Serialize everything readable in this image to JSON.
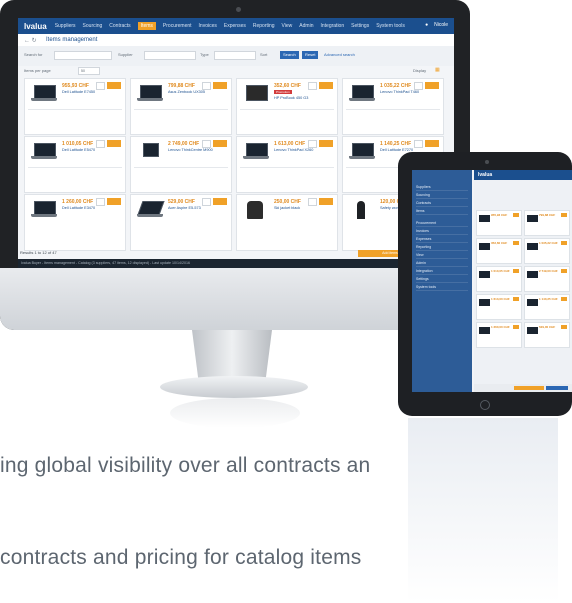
{
  "app": {
    "logo": "Ivalua",
    "nav": [
      "Suppliers",
      "Sourcing",
      "Contracts",
      "Items",
      "Procurement",
      "Invoices",
      "Expenses",
      "Reporting",
      "View",
      "Admin",
      "Integration",
      "Settings",
      "System tools"
    ],
    "active_nav": "Items",
    "user": "Nicole",
    "page_title": "Items management",
    "filters": {
      "search_label": "Search for",
      "supplier_label": "Supplier",
      "type_label": "Type",
      "sort_label": "Sort",
      "search_button": "Search",
      "reset_button": "Reset",
      "advanced_link": "Advanced search",
      "per_page_label": "Items per page",
      "per_page_value": "50",
      "display_label": "Display"
    },
    "products": [
      {
        "price": "955,93 CHF",
        "name": "Dell Latitude E7450",
        "image": "laptop"
      },
      {
        "price": "799,88 CHF",
        "name": "Asus Zenbook UX305",
        "image": "laptop"
      },
      {
        "price": "352,60 CHF",
        "name": "HP ProBook 450 G3",
        "image": "printer",
        "badge": "Promotion"
      },
      {
        "price": "1 035,22 CHF",
        "name": "Lenovo ThinkPad T460",
        "image": "laptop"
      },
      {
        "price": "1 010,05 CHF",
        "name": "Dell Latitude E5470",
        "image": "laptop"
      },
      {
        "price": "2 749,00 CHF",
        "name": "Lenovo ThinkCentre M900",
        "image": "desktop"
      },
      {
        "price": "1 613,00 CHF",
        "name": "Lenovo ThinkPad X260",
        "image": "laptop"
      },
      {
        "price": "1 140,25 CHF",
        "name": "Dell Latitude E7270",
        "image": "laptop"
      },
      {
        "price": "1 260,00 CHF",
        "name": "Dell Latitude E3470",
        "image": "laptop"
      },
      {
        "price": "529,00 CHF",
        "name": "Acer Aspire E5-573",
        "image": "laptop"
      },
      {
        "price": "250,00 CHF",
        "name": "Ski jacket black",
        "image": "jacket"
      },
      {
        "price": "120,00 CHF",
        "name": "Safety work overalls",
        "image": "person"
      }
    ],
    "pager": "Results 1 to 12 of 47",
    "cta": "Add items to punchout cart",
    "statusbar": "Ivalua Buyer - Items management - Catalog (3 suppliers, 47 items, 12 displayed) - Last update 10/14/2016"
  },
  "tablet": {
    "logo": "Ivalua",
    "sidebar": [
      "Suppliers",
      "Sourcing",
      "Contracts",
      "Items",
      "Procurement",
      "Invoices",
      "Expenses",
      "Reporting",
      "View",
      "Admin",
      "Integration",
      "Settings",
      "System tools"
    ]
  },
  "captions": {
    "line1": "ing global visibility over all contracts an",
    "line2": "contracts and pricing for catalog items"
  }
}
